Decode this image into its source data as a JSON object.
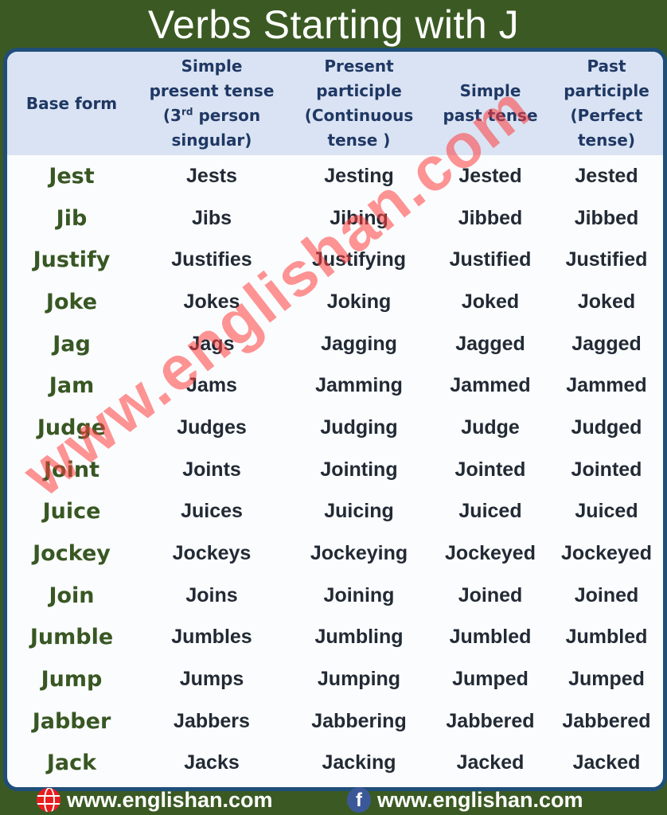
{
  "title": "Verbs Starting with J",
  "table": {
    "headers": [
      {
        "text": "Base form"
      },
      {
        "pre": "Simple\npresent tense\n(3",
        "sup": "rd",
        "post": " person\nsingular)"
      },
      {
        "text": "Present\nparticiple\n(Continuous\ntense )"
      },
      {
        "text": "Simple\npast tense"
      },
      {
        "text": "Past\nparticiple\n(Perfect\ntense)"
      }
    ],
    "rows": [
      [
        "Jest",
        "Jests",
        "Jesting",
        "Jested",
        "Jested"
      ],
      [
        "Jib",
        "Jibs",
        "Jibing",
        "Jibbed",
        "Jibbed"
      ],
      [
        "Justify",
        "Justifies",
        "Justifying",
        "Justified",
        "Justified"
      ],
      [
        "Joke",
        "Jokes",
        "Joking",
        "Joked",
        "Joked"
      ],
      [
        "Jag",
        "Jags",
        "Jagging",
        "Jagged",
        "Jagged"
      ],
      [
        "Jam",
        "Jams",
        "Jamming",
        "Jammed",
        "Jammed"
      ],
      [
        "Judge",
        "Judges",
        "Judging",
        "Judge",
        "Judged"
      ],
      [
        "Joint",
        "Joints",
        "Jointing",
        "Jointed",
        "Jointed"
      ],
      [
        "Juice",
        "Juices",
        "Juicing",
        "Juiced",
        "Juiced"
      ],
      [
        "Jockey",
        "Jockeys",
        "Jockeying",
        "Jockeyed",
        "Jockeyed"
      ],
      [
        "Join",
        "Joins",
        "Joining",
        "Joined",
        "Joined"
      ],
      [
        "Jumble",
        "Jumbles",
        "Jumbling",
        "Jumbled",
        "Jumbled"
      ],
      [
        "Jump",
        "Jumps",
        "Jumping",
        "Jumped",
        "Jumped"
      ],
      [
        "Jabber",
        "Jabbers",
        "Jabbering",
        "Jabbered",
        "Jabbered"
      ],
      [
        "Jack",
        "Jacks",
        "Jacking",
        "Jacked",
        "Jacked"
      ]
    ]
  },
  "watermark": "www.englishan.com",
  "footer": {
    "website": {
      "icon": "globe-icon",
      "text": "www.englishan.com"
    },
    "facebook": {
      "icon": "facebook-icon",
      "glyph": "f",
      "text": "www.englishan.com"
    }
  },
  "colors": {
    "background": "#3b5a23",
    "panel_border": "#1f4e79",
    "header_bg": "#dae3f3",
    "header_text": "#1f3864",
    "base_text": "#385723",
    "body_text": "#222a35",
    "watermark": "#ff3c3c"
  }
}
